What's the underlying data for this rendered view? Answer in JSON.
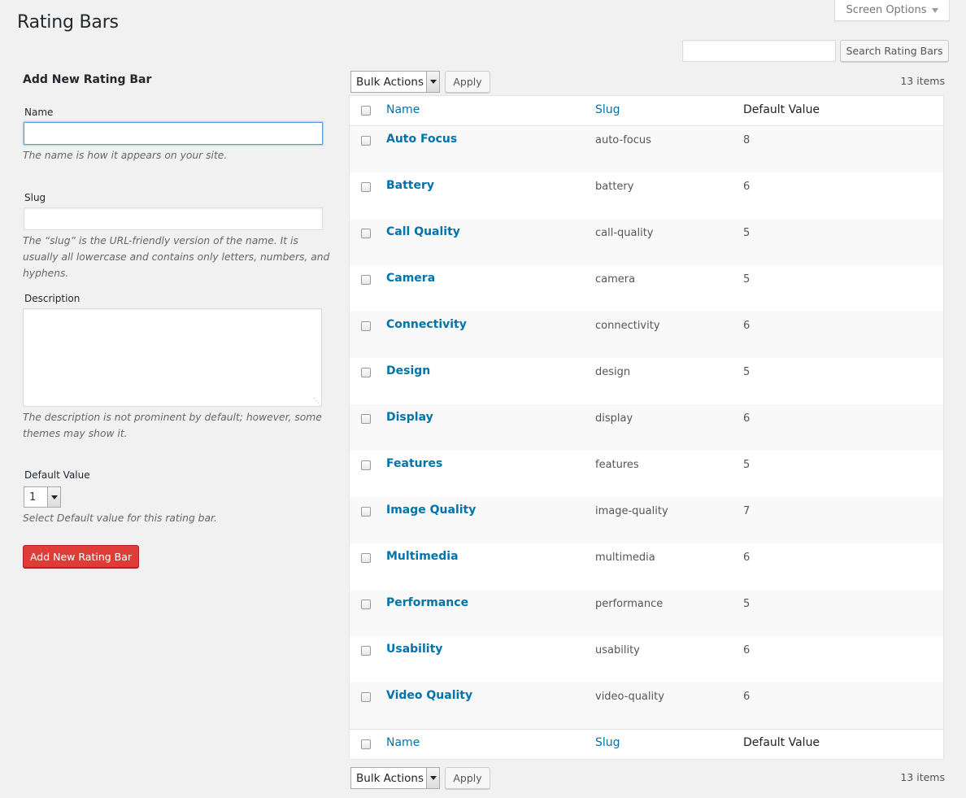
{
  "header": {
    "title": "Rating Bars",
    "screen_options": "Screen Options"
  },
  "search": {
    "value": "",
    "button": "Search Rating Bars"
  },
  "form": {
    "heading": "Add New Rating Bar",
    "name_label": "Name",
    "name_value": "",
    "name_hint": "The name is how it appears on your site.",
    "slug_label": "Slug",
    "slug_value": "",
    "slug_hint": "The “slug” is the URL-friendly version of the name. It is usually all lowercase and contains only letters, numbers, and hyphens.",
    "description_label": "Description",
    "description_value": "",
    "description_hint": "The description is not prominent by default; however, some themes may show it.",
    "default_label": "Default Value",
    "default_selected": "1",
    "default_hint": "Select Default value for this rating bar.",
    "submit": "Add New Rating Bar"
  },
  "bulk": {
    "selected": "Bulk Actions",
    "apply": "Apply",
    "count": "13 items"
  },
  "table": {
    "columns": [
      "Name",
      "Slug",
      "Default Value"
    ],
    "rows": [
      {
        "name": "Auto Focus",
        "slug": "auto-focus",
        "value": "8"
      },
      {
        "name": "Battery",
        "slug": "battery",
        "value": "6"
      },
      {
        "name": "Call Quality",
        "slug": "call-quality",
        "value": "5"
      },
      {
        "name": "Camera",
        "slug": "camera",
        "value": "5"
      },
      {
        "name": "Connectivity",
        "slug": "connectivity",
        "value": "6"
      },
      {
        "name": "Design",
        "slug": "design",
        "value": "5"
      },
      {
        "name": "Display",
        "slug": "display",
        "value": "6"
      },
      {
        "name": "Features",
        "slug": "features",
        "value": "5"
      },
      {
        "name": "Image Quality",
        "slug": "image-quality",
        "value": "7"
      },
      {
        "name": "Multimedia",
        "slug": "multimedia",
        "value": "6"
      },
      {
        "name": "Performance",
        "slug": "performance",
        "value": "5"
      },
      {
        "name": "Usability",
        "slug": "usability",
        "value": "6"
      },
      {
        "name": "Video Quality",
        "slug": "video-quality",
        "value": "6"
      }
    ]
  },
  "colors": {
    "link": "#0073aa",
    "danger_button": "#dd3d36",
    "background": "#f1f1f1"
  }
}
